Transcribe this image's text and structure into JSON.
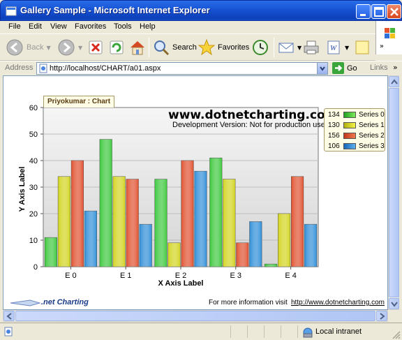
{
  "window": {
    "title": "Gallery Sample - Microsoft Internet Explorer"
  },
  "menu": [
    "File",
    "Edit",
    "View",
    "Favorites",
    "Tools",
    "Help"
  ],
  "toolbar": {
    "back_label": "Back",
    "search_label": "Search",
    "favorites_label": "Favorites"
  },
  "address": {
    "label": "Address",
    "url": "http://localhost/CHART/a01.aspx",
    "go_label": "Go",
    "links_label": "Links"
  },
  "chart_header": {
    "tab": "Priyokumar : Chart",
    "watermark_url": "www.dotnetcharting.com",
    "watermark_note": "Development Version: Not for production use."
  },
  "chart_data": {
    "type": "bar",
    "categories": [
      "E 0",
      "E 1",
      "E 2",
      "E 3",
      "E 4"
    ],
    "series": [
      {
        "name": "Series 0",
        "values": [
          11,
          48,
          33,
          41,
          1
        ],
        "total": "134",
        "color": "#3cc83c"
      },
      {
        "name": "Series 1",
        "values": [
          34,
          34,
          9,
          33,
          20
        ],
        "total": "130",
        "color": "#d2d41e"
      },
      {
        "name": "Series 2",
        "values": [
          40,
          33,
          40,
          9,
          34
        ],
        "total": "156",
        "color": "#e0502e"
      },
      {
        "name": "Series 3",
        "values": [
          21,
          16,
          36,
          17,
          16
        ],
        "total": "106",
        "color": "#2f8ed8"
      }
    ],
    "xlabel": "X Axis Label",
    "ylabel": "Y Axis Label",
    "ylim": [
      0,
      60
    ],
    "yticks": [
      0,
      10,
      20,
      30,
      40,
      50,
      60
    ],
    "grid": true,
    "legend_position": "right"
  },
  "footer": {
    "logo_text": ".net Charting",
    "info_text": "For more information visit",
    "link_text": "http://www.dotnetcharting.com"
  },
  "status": {
    "zone": "Local intranet"
  }
}
